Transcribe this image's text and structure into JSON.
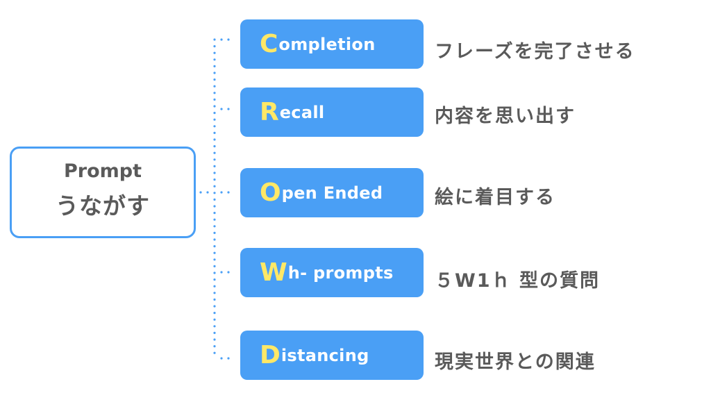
{
  "root": {
    "label_en": "Prompt",
    "label_ja": "うながす"
  },
  "colors": {
    "accent_blue": "#4a9ff5",
    "initial_yellow": "#ffe866",
    "text_gray": "#5a5a5a",
    "node_text": "#ffffff"
  },
  "items": [
    {
      "initial": "C",
      "rest": "ompletion",
      "description": "フレーズを完了させる"
    },
    {
      "initial": "R",
      "rest": "ecall",
      "description": "内容を思い出す"
    },
    {
      "initial": "O",
      "rest": "pen Ended",
      "description": "絵に着目する"
    },
    {
      "initial": "W",
      "rest": "h- prompts",
      "description": "５W1ｈ 型の質問"
    },
    {
      "initial": "D",
      "rest": "istancing",
      "description": "現実世界との関連"
    }
  ]
}
